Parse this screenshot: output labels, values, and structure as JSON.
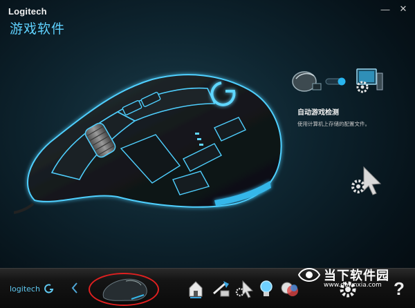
{
  "window": {
    "brand": "Logitech",
    "subtitle": "游戏软件",
    "minimize_symbol": "—",
    "close_symbol": "✕"
  },
  "mode_panel": {
    "title": "自动游戏检测",
    "description": "使用计算机上存储的配置文件。",
    "toggle_state": "on"
  },
  "toolbar": {
    "logo_text": "logitech",
    "logo_icon": "logitech-g-icon",
    "selected_device": "G502 gaming mouse",
    "tools": [
      {
        "name": "home-icon"
      },
      {
        "name": "customize-buttons-icon"
      },
      {
        "name": "pointer-settings-icon"
      },
      {
        "name": "lighting-bulb-icon"
      },
      {
        "name": "heatmap-icon"
      },
      {
        "name": "settings-gear-icon"
      },
      {
        "name": "help-icon",
        "label": "?"
      }
    ]
  },
  "watermark": {
    "title": "当下软件园",
    "url": "www.downxia.com"
  },
  "colors": {
    "accent": "#4fd0ff",
    "background": "#0e2530",
    "highlight_ring": "#e02020"
  }
}
